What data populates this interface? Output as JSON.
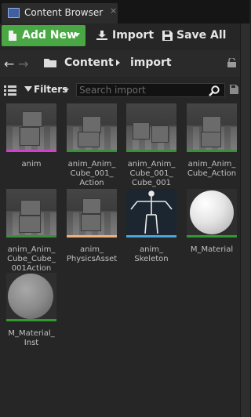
{
  "tab": {
    "title": "Content Browser",
    "icon": "content-browser-icon",
    "close_glyph": "×"
  },
  "toolbar": {
    "add_new_label": "Add New",
    "import_label": "Import",
    "save_all_label": "Save All"
  },
  "path": {
    "back_glyph": "←",
    "forward_glyph": "→",
    "crumbs": [
      "Content",
      "import"
    ]
  },
  "filters": {
    "label": "Filters",
    "search_placeholder": "Search import"
  },
  "colors": {
    "accent_green": "#49a844",
    "anim_magenta": "#d23fcf",
    "mesh_green": "#3a8f3a",
    "physics_orange": "#f0b27a",
    "skeleton_blue": "#4aa6d8",
    "material_green": "#2f9b2f"
  },
  "assets": [
    {
      "name": "anim",
      "type": "animation"
    },
    {
      "name": "anim_Anim_\nCube_001_\nAction",
      "type": "static-mesh"
    },
    {
      "name": "anim_Anim_\nCube_001_\nCube_001",
      "type": "static-mesh"
    },
    {
      "name": "anim_Anim_\nCube_Action",
      "type": "static-mesh"
    },
    {
      "name": "anim_Anim_\nCube_Cube_\n001Action",
      "type": "static-mesh"
    },
    {
      "name": "anim_\nPhysicsAsset",
      "type": "physics-asset"
    },
    {
      "name": "anim_\nSkeleton",
      "type": "skeleton"
    },
    {
      "name": "M_Material",
      "type": "material"
    },
    {
      "name": "M_Material_\nInst",
      "type": "material-instance"
    }
  ]
}
